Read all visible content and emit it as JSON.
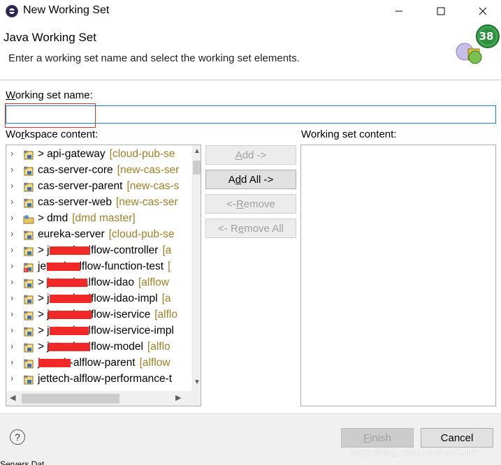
{
  "window": {
    "title": "New Working Set",
    "controls": {
      "minimize": "—",
      "maximize": "☐",
      "close": "✕"
    },
    "app_icon": "eclipse-icon"
  },
  "header": {
    "title": "Java Working Set",
    "description": "Enter a working set name and select the working set elements.",
    "banner_badge": "38",
    "banner_icon": "working-set-wizard-banner"
  },
  "form": {
    "name_label": "Working set name:",
    "name_value": "",
    "workspace_label": "Workspace content:",
    "working_set_label": "Working set content:"
  },
  "workspace_tree": [
    {
      "prefix": "> ",
      "name": "api-gateway",
      "branch": "[cloud-pub-se",
      "icon": "maven-project-icon"
    },
    {
      "prefix": "",
      "name": "cas-server-core",
      "branch": "[new-cas-ser",
      "icon": "maven-project-icon"
    },
    {
      "prefix": "",
      "name": "cas-server-parent",
      "branch": "[new-cas-s",
      "icon": "maven-project-icon"
    },
    {
      "prefix": "",
      "name": "cas-server-web",
      "branch": "[new-cas-ser",
      "icon": "maven-project-icon"
    },
    {
      "prefix": "> ",
      "name": "dmd",
      "branch": "[dmd master]",
      "icon": "folder-project-icon"
    },
    {
      "prefix": "",
      "name": "eureka-server",
      "branch": "[cloud-pub-se",
      "icon": "maven-project-icon"
    },
    {
      "prefix": "> ",
      "name": "jettech-alflow-controller",
      "branch": "[a",
      "icon": "maven-project-icon"
    },
    {
      "prefix": "",
      "name": "jettech-alflow-function-test",
      "branch": "[",
      "icon": "error-project-icon"
    },
    {
      "prefix": "> ",
      "name": "jettech-alflow-idao",
      "branch": "[alflow",
      "icon": "maven-project-icon"
    },
    {
      "prefix": "> ",
      "name": "jettech-alflow-idao-impl",
      "branch": "[a",
      "icon": "maven-project-icon"
    },
    {
      "prefix": "> ",
      "name": "jettech-alflow-iservice",
      "branch": "[alflo",
      "icon": "maven-project-icon"
    },
    {
      "prefix": "> ",
      "name": "jettech-alflow-iservice-impl",
      "branch": "",
      "icon": "maven-project-icon"
    },
    {
      "prefix": "> ",
      "name": "jettech-alflow-model",
      "branch": "[alflo",
      "icon": "maven-project-icon"
    },
    {
      "prefix": "",
      "name": "jettech-alflow-parent",
      "branch": "[alflow",
      "icon": "maven-project-icon"
    },
    {
      "prefix": "",
      "name": "jettech-alflow-performance-t",
      "branch": "",
      "icon": "maven-project-icon"
    }
  ],
  "buttons": {
    "add": "Add ->",
    "add_all": "Add All ->",
    "remove": "<- Remove",
    "remove_all": "<- Remove All",
    "finish": "Finish",
    "cancel": "Cancel",
    "help": "?"
  },
  "watermark": "https://blog.csdn.net/justDolfit",
  "bottom_strip": "Servers  Dat"
}
